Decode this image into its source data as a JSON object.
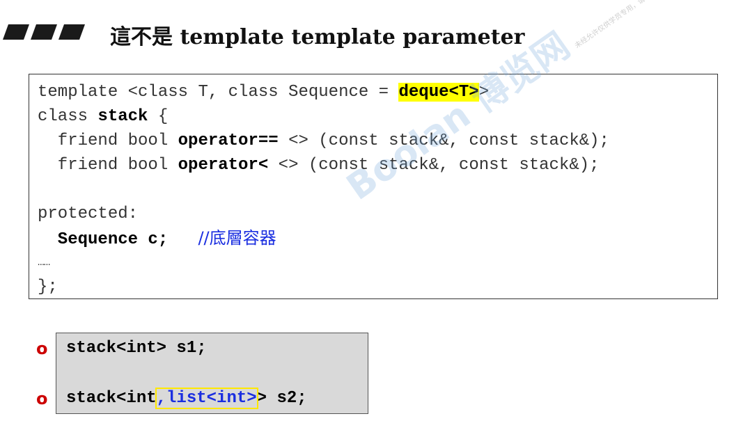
{
  "header": {
    "title": "這不是 template template parameter"
  },
  "code": {
    "line1_pre": "template <class T, class Sequence = ",
    "line1_hl": "deque<T>",
    "line1_post": ">",
    "line2_pre": "class ",
    "line2_bold": "stack",
    "line2_post": " {",
    "line3_pre": "  friend bool ",
    "line3_bold": "operator==",
    "line3_post": " <> (const stack&, const stack&);",
    "line4_pre": "  friend bool ",
    "line4_bold": "operator<",
    "line4_post": " <> (const stack&, const stack&);",
    "line6": "protected:",
    "line7_bold": "  Sequence c;",
    "line7_comment": "//底層容器",
    "line8": "……",
    "line9": "};"
  },
  "watermark": {
    "brand": "Boolan 博览网",
    "notice": "未经允许仅供学员专用，请勿线上传播，侵害侵犯者将依法追究法律责任。"
  },
  "examples": {
    "bullet": "o",
    "line1": "stack<int> s1;",
    "line2_pre": "stack<int",
    "line2_hl": ",list<int>",
    "line2_post": "> s2;"
  },
  "colors": {
    "highlight": "#ffff00",
    "comment": "#1a2ee0",
    "bullet": "#cc0000",
    "example_bg": "#d9d9d9"
  }
}
